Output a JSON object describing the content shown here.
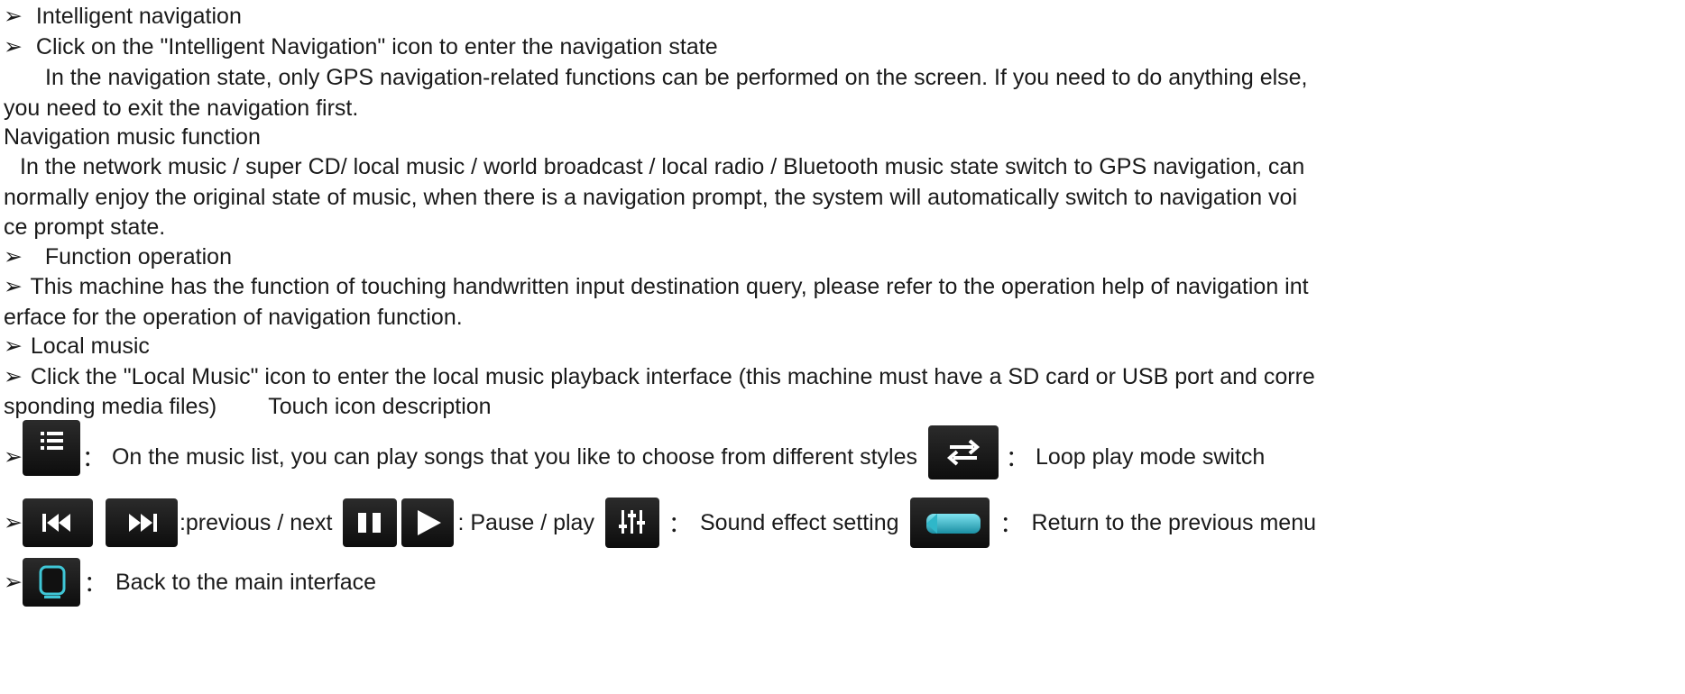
{
  "bullet": "➢",
  "line1": "Intelligent navigation",
  "line2": "Click on the \"Intelligent Navigation\" icon to enter the navigation state",
  "line3": "In the navigation state, only GPS navigation-related functions can be performed on the screen. If you need to do anything else,",
  "line4": "you need to exit the navigation first.",
  "line5": "Navigation music function",
  "line6": "In the network music / super CD/ local music / world broadcast / local radio / Bluetooth music state switch to GPS navigation, can",
  "line7": "normally enjoy the original state of music, when there is a navigation prompt, the system will automatically switch to navigation voi",
  "line8": "ce prompt state.",
  "line9": "Function operation",
  "line10": "This machine has the function of touching handwritten input destination query, please refer to the operation help of navigation int",
  "line11": "erface for the operation of navigation function.",
  "line12": "Local music",
  "line13": "Click the \"Local Music\" icon to enter the local music playback interface (this machine must have a SD card or USB port and corre",
  "line14a": "sponding media files)",
  "line14b": "Touch icon description",
  "row1": {
    "desc_list": "On the music list, you can play songs that you like to choose from different styles",
    "desc_loop": "Loop play mode switch",
    "sep": "："
  },
  "row2": {
    "desc_prevnext": ":previous / next",
    "desc_pauseplay": ": Pause / play",
    "desc_sound": "Sound effect setting",
    "desc_return": "Return to the previous menu",
    "sep": "："
  },
  "row3": {
    "desc_home": "Back to the main interface",
    "sep": "："
  },
  "icons": [
    "list-icon",
    "loop-icon",
    "previous-icon",
    "next-icon",
    "pause-icon",
    "play-icon",
    "equalizer-icon",
    "return-icon",
    "home-icon"
  ],
  "colors": {
    "text": "#1a1a1a",
    "icon_bg": "#1c1c1c",
    "accent": "#2fb7c9"
  }
}
